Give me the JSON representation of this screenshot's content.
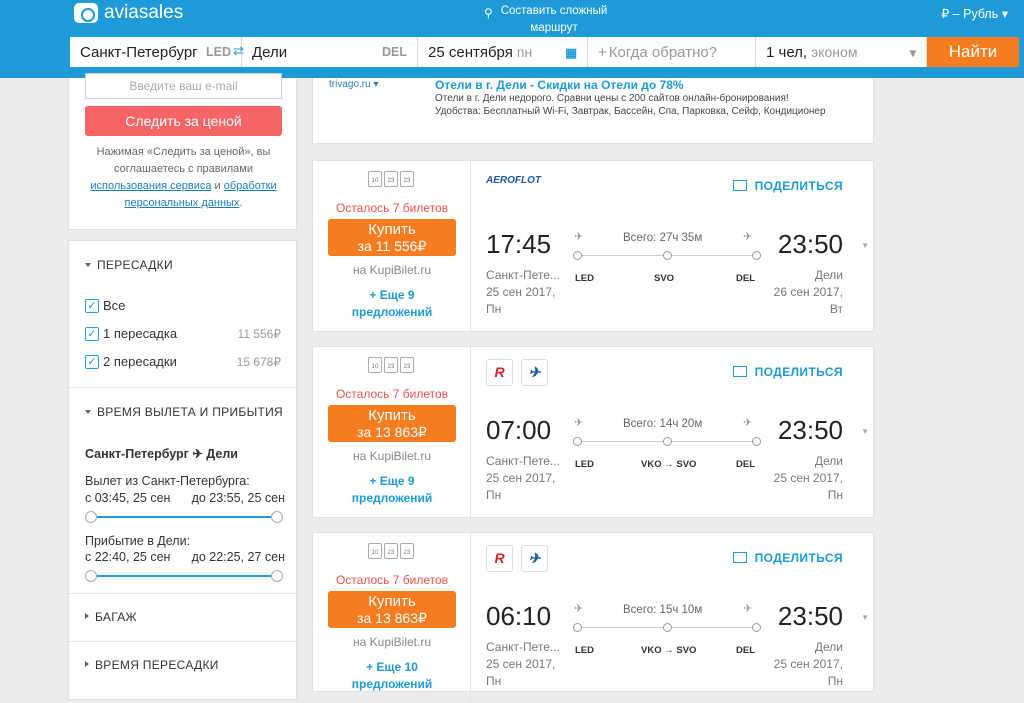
{
  "header": {
    "brand": "aviasales",
    "complex_route": "Составить сложный маршрут",
    "currency": "₽ – Рубль"
  },
  "search": {
    "origin": "Санкт-Петербург",
    "origin_code": "LED",
    "destination": "Дели",
    "destination_code": "DEL",
    "depart_date": "25 сентября",
    "depart_day": "пн",
    "return_placeholder": "Когда обратно?",
    "passengers": "1 чел,",
    "cabin": "эконом",
    "find_label": "Найти"
  },
  "alerts": {
    "email_placeholder": "Введите ваш e-mail",
    "follow_label": "Следить за ценой",
    "note_prefix": "Нажимая «Следить за ценой», вы соглашаетесь с правилами",
    "note_link1": "использования сервиса",
    "note_and": "и",
    "note_link2": "обработки персональных данных"
  },
  "filters": {
    "stops_title": "ПЕРЕСАДКИ",
    "stops": [
      {
        "label": "Все",
        "price": ""
      },
      {
        "label": "1 пересадка",
        "price": "11 556₽"
      },
      {
        "label": "2 пересадки",
        "price": "15 678₽"
      }
    ],
    "times_title": "ВРЕМЯ ВЫЛЕТА И ПРИБЫТИЯ",
    "route": "Санкт-Петербург ✈ Дели",
    "depart_label": "Вылет из Санкт-Петербурга:",
    "depart_from": "с 03:45, 25 сен",
    "depart_to": "до 23:55, 25 сен",
    "arrive_label": "Прибытие в Дели:",
    "arrive_from": "с 22:40, 25 сен",
    "arrive_to": "до 22:25, 27 сен",
    "baggage_title": "БАГАЖ",
    "layover_title": "ВРЕМЯ ПЕРЕСАДКИ"
  },
  "ad": {
    "logo": "trivago.ru ▾",
    "title": "Отели в г. Дели - Скидки на Отели до 78%",
    "line1": "Отели в г. Дели недорого. Сравни цены с 200 сайтов онлайн-бронирования!",
    "line2": "Удобства: Бесплатный Wi-Fi, Завтрак, Бассейн, Спа, Парковка, Сейф, Кондиционер"
  },
  "tickets": [
    {
      "seats_left": "Осталось 7 билетов",
      "buy": "Купить",
      "price": "за 11 556₽",
      "site": "на KupiBilet.ru",
      "more": "+ Еще 9 предложений",
      "share": "ПОДЕЛИТЬСЯ",
      "airline": "AEROFLOT",
      "dep": "17:45",
      "arr": "23:50",
      "total": "Всего: 27ч 35м",
      "c1": "LED",
      "c2": "SVO",
      "c3": "DEL",
      "from_city": "Санкт-Пете...",
      "from_date": "25 сен 2017,",
      "from_day": "Пн",
      "to_city": "Дели",
      "to_date": "26 сен 2017,",
      "to_day": "Вт"
    },
    {
      "seats_left": "Осталось 7 билетов",
      "buy": "Купить",
      "price": "за 13 863₽",
      "site": "на KupiBilet.ru",
      "more": "+ Еще 9 предложений",
      "share": "ПОДЕЛИТЬСЯ",
      "airline": "",
      "dep": "07:00",
      "arr": "23:50",
      "total": "Всего: 14ч 20м",
      "c1": "LED",
      "c2": "VKO → SVO",
      "c3": "DEL",
      "from_city": "Санкт-Пете...",
      "from_date": "25 сен 2017,",
      "from_day": "Пн",
      "to_city": "Дели",
      "to_date": "25 сен 2017,",
      "to_day": "Пн"
    },
    {
      "seats_left": "Осталось 7 билетов",
      "buy": "Купить",
      "price": "за 13 863₽",
      "site": "на KupiBilet.ru",
      "more": "+ Еще 10 предложений",
      "share": "ПОДЕЛИТЬСЯ",
      "airline": "",
      "dep": "06:10",
      "arr": "23:50",
      "total": "Всего: 15ч 10м",
      "c1": "LED",
      "c2": "VKO → SVO",
      "c3": "DEL",
      "from_city": "Санкт-Пете...",
      "from_date": "25 сен 2017,",
      "from_day": "Пн",
      "to_city": "Дели",
      "to_date": "25 сен 2017,",
      "to_day": "Пн"
    }
  ]
}
